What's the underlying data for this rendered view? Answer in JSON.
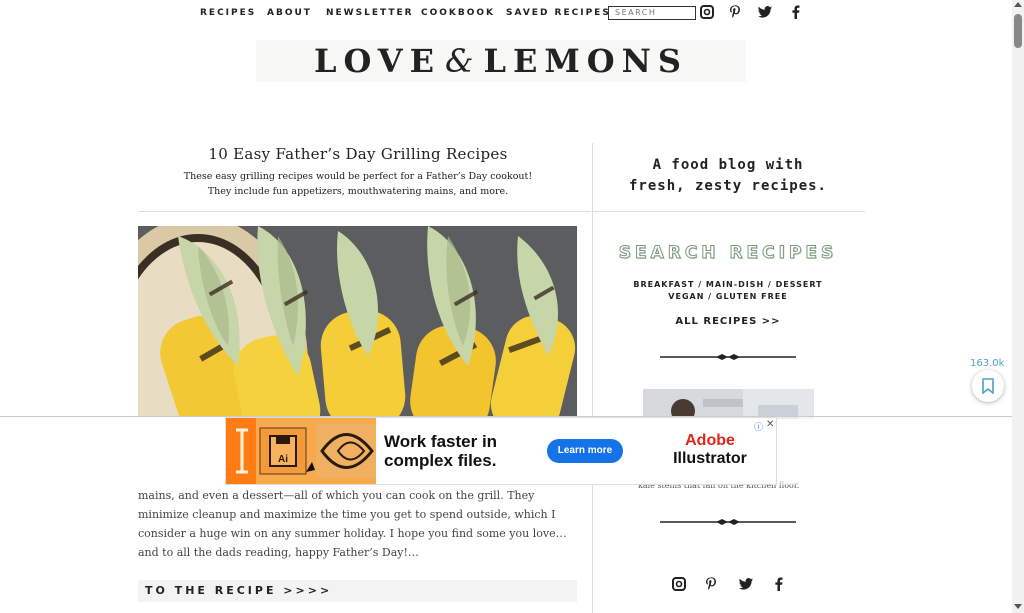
{
  "nav": {
    "items": [
      "RECIPES",
      "ABOUT",
      "NEWSLETTER",
      "COOKBOOK",
      "SAVED RECIPES"
    ],
    "search_placeholder": "SEARCH",
    "social_icons": [
      "instagram-icon",
      "pinterest-icon",
      "twitter-icon",
      "facebook-icon"
    ]
  },
  "logo": {
    "left": "LOVE",
    "amp": "&",
    "right": "LEMONS"
  },
  "post": {
    "title": "10 Easy Father’s Day Grilling Recipes",
    "subtitle_line1": "These easy grilling recipes would be perfect for a Father’s Day cookout!",
    "subtitle_line2": "They include fun appetizers, mouthwatering mains, and more.",
    "body": "mains, and even a dessert—all of which you can cook on the grill. They minimize cleanup and maximize the time you get to spend outside, which I consider a huge win on any summer holiday. I hope you find some you love…and to all the dads reading, happy Father’s Day!…",
    "cta": "TO THE RECIPE >>>>"
  },
  "sidebar": {
    "tagline_line1": "A food blog with",
    "tagline_line2": "fresh, zesty recipes.",
    "search_title": "SEARCH RECIPES",
    "categories_line1": "BREAKFAST  /  MAIN-DISH  /  DESSERT",
    "categories_line2": "VEGAN  /  GLUTEN FREE",
    "all_recipes": "ALL RECIPES >>",
    "photo_caption": "kale stems that fall on the kitchen floor."
  },
  "share": {
    "count": "163.0k"
  },
  "ad": {
    "headline": "Work faster in complex files.",
    "cta": "Learn more",
    "brand_line1": "Adobe",
    "brand_line2": "Illustrator",
    "info": "ⓘ",
    "close": "✕",
    "app_label": "Ai",
    "accent": "#e1251b",
    "button_color": "#1473e6"
  }
}
